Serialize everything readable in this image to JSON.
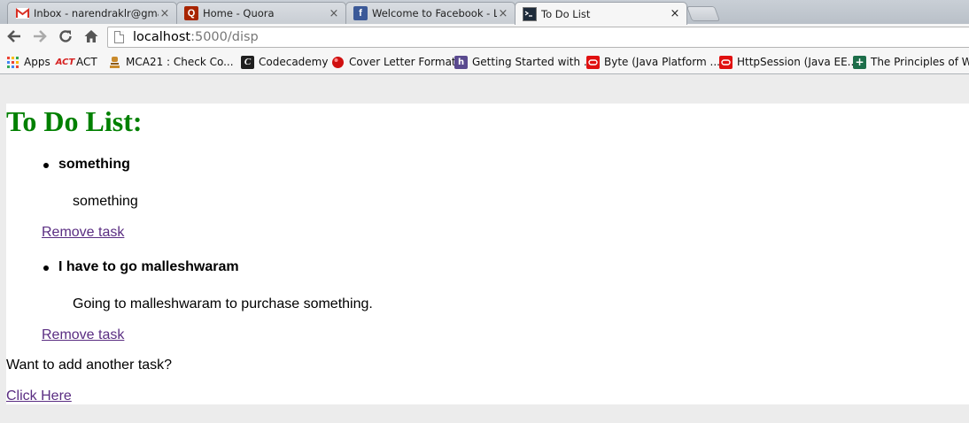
{
  "browser": {
    "tabs": [
      {
        "title": "Inbox - narendraklr@gmai",
        "icon": "gmail-icon"
      },
      {
        "title": "Home - Quora",
        "icon": "quora-icon"
      },
      {
        "title": "Welcome to Facebook - Lo",
        "icon": "facebook-icon"
      },
      {
        "title": "To Do List",
        "icon": "terminal-icon",
        "active": true
      }
    ],
    "tab_close": "×",
    "url_host": "localhost",
    "url_rest": ":5000/disp",
    "bookmarks": [
      {
        "label": "Apps",
        "icon": "apps-grid-icon"
      },
      {
        "label": "ACT",
        "icon": "act-icon"
      },
      {
        "label": "MCA21 : Check Co...",
        "icon": "emblem-icon"
      },
      {
        "label": "Codecademy",
        "icon": "codecademy-icon"
      },
      {
        "label": "Cover Letter Format",
        "icon": "red-ball-icon"
      },
      {
        "label": "Getting Started with ...",
        "icon": "heroku-icon"
      },
      {
        "label": "Byte (Java Platform ...",
        "icon": "oracle-icon"
      },
      {
        "label": "HttpSession (Java EE...",
        "icon": "oracle-icon"
      },
      {
        "label": "The Principles of We...",
        "icon": "green-plus-icon"
      }
    ]
  },
  "page": {
    "heading": "To Do List:",
    "tasks": [
      {
        "title": "something",
        "description": "something",
        "remove_label": "Remove task"
      },
      {
        "title": "I have to go malleshwaram",
        "description": "Going to malleshwaram to purchase something.",
        "remove_label": "Remove task"
      }
    ],
    "add_prompt": "Want to add another task?",
    "add_link": "Click Here"
  },
  "colors": {
    "heading": "#008000",
    "link": "#5a2d82"
  }
}
